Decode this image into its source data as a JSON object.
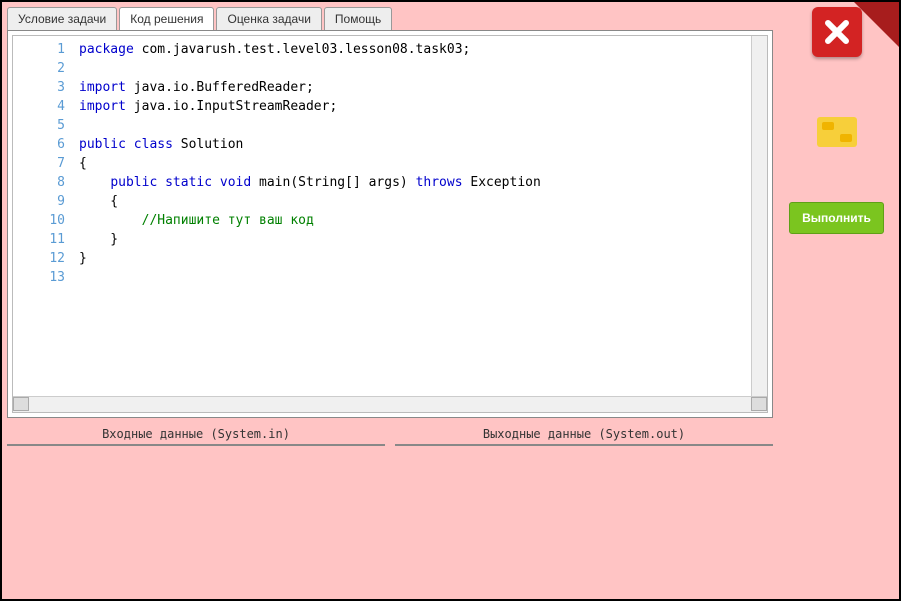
{
  "tabs": [
    {
      "label": "Условие задачи",
      "active": false
    },
    {
      "label": "Код решения",
      "active": true
    },
    {
      "label": "Оценка задачи",
      "active": false
    },
    {
      "label": "Помощь",
      "active": false
    }
  ],
  "code": {
    "lines": [
      [
        {
          "t": "package",
          "c": "kw"
        },
        {
          "t": " com.javarush.test.level03.lesson08.task03;",
          "c": ""
        }
      ],
      [],
      [
        {
          "t": "import",
          "c": "kw"
        },
        {
          "t": " java.io.BufferedReader;",
          "c": ""
        }
      ],
      [
        {
          "t": "import",
          "c": "kw"
        },
        {
          "t": " java.io.InputStreamReader;",
          "c": ""
        }
      ],
      [],
      [
        {
          "t": "public class",
          "c": "kw"
        },
        {
          "t": " Solution",
          "c": ""
        }
      ],
      [
        {
          "t": "{",
          "c": ""
        }
      ],
      [
        {
          "t": "    ",
          "c": ""
        },
        {
          "t": "public static void",
          "c": "kw"
        },
        {
          "t": " main(String[] args) ",
          "c": ""
        },
        {
          "t": "throws",
          "c": "kw"
        },
        {
          "t": " Exception",
          "c": ""
        }
      ],
      [
        {
          "t": "    {",
          "c": ""
        }
      ],
      [
        {
          "t": "        ",
          "c": ""
        },
        {
          "t": "//Напишите тут ваш код",
          "c": "cm"
        }
      ],
      [
        {
          "t": "    }",
          "c": ""
        }
      ],
      [
        {
          "t": "}",
          "c": ""
        }
      ],
      []
    ]
  },
  "sidebar": {
    "run_label": "Выполнить"
  },
  "io": {
    "input_label": "Входные данные (System.in)",
    "output_label": "Выходные данные (System.out)"
  }
}
